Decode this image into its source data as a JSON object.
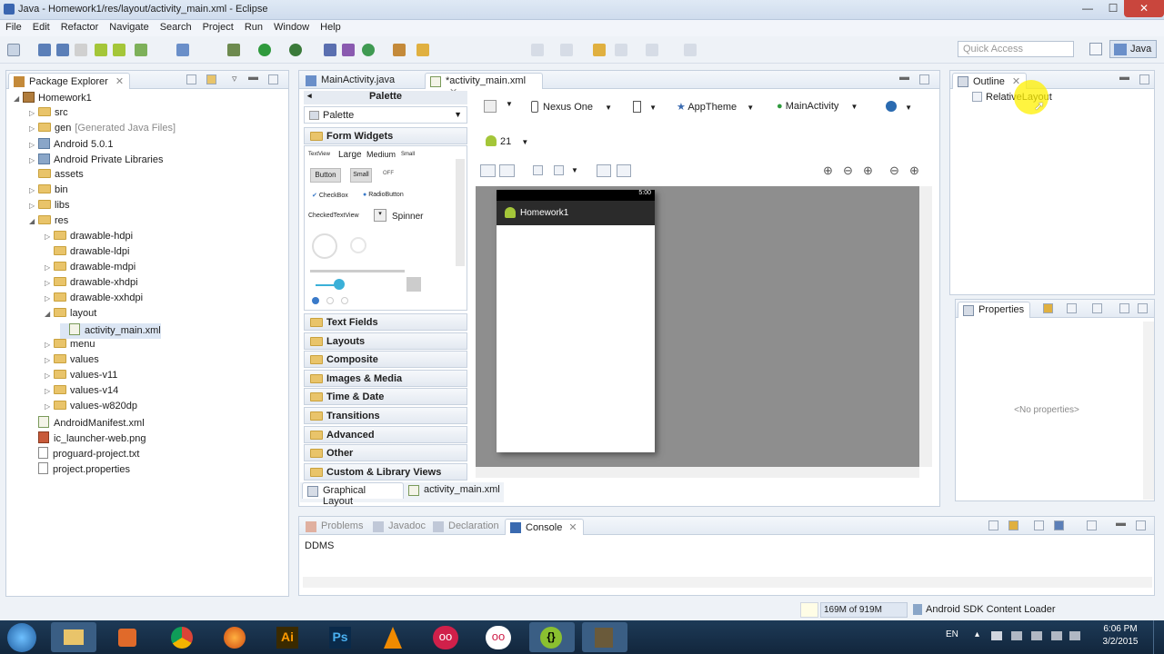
{
  "window": {
    "title": "Java - Homework1/res/layout/activity_main.xml - Eclipse",
    "minimize": "—",
    "maximize": "☐",
    "close": "✕"
  },
  "menu": [
    "File",
    "Edit",
    "Refactor",
    "Navigate",
    "Search",
    "Project",
    "Run",
    "Window",
    "Help"
  ],
  "quick_access": {
    "placeholder": "Quick Access"
  },
  "perspective": "Java",
  "package_explorer": {
    "title": "Package Explorer",
    "close": "✕",
    "tree": [
      {
        "label": "Homework1",
        "level": 0,
        "arrow": "◢",
        "icon": "project"
      },
      {
        "label": "src",
        "level": 1,
        "arrow": "▷",
        "icon": "folder"
      },
      {
        "label": "gen",
        "suffix": "[Generated Java Files]",
        "level": 1,
        "arrow": "▷",
        "icon": "folder"
      },
      {
        "label": "Android 5.0.1",
        "level": 1,
        "arrow": "▷",
        "icon": "lib"
      },
      {
        "label": "Android Private Libraries",
        "level": 1,
        "arrow": "▷",
        "icon": "lib"
      },
      {
        "label": "assets",
        "level": 1,
        "arrow": "",
        "icon": "folder"
      },
      {
        "label": "bin",
        "level": 1,
        "arrow": "▷",
        "icon": "folder"
      },
      {
        "label": "libs",
        "level": 1,
        "arrow": "▷",
        "icon": "folder"
      },
      {
        "label": "res",
        "level": 1,
        "arrow": "◢",
        "icon": "folder"
      },
      {
        "label": "drawable-hdpi",
        "level": 2,
        "arrow": "▷",
        "icon": "folder"
      },
      {
        "label": "drawable-ldpi",
        "level": 2,
        "arrow": "",
        "icon": "folder"
      },
      {
        "label": "drawable-mdpi",
        "level": 2,
        "arrow": "▷",
        "icon": "folder"
      },
      {
        "label": "drawable-xhdpi",
        "level": 2,
        "arrow": "▷",
        "icon": "folder"
      },
      {
        "label": "drawable-xxhdpi",
        "level": 2,
        "arrow": "▷",
        "icon": "folder"
      },
      {
        "label": "layout",
        "level": 2,
        "arrow": "◢",
        "icon": "folder"
      },
      {
        "label": "activity_main.xml",
        "level": 3,
        "arrow": "",
        "icon": "xml",
        "selected": true
      },
      {
        "label": "menu",
        "level": 2,
        "arrow": "▷",
        "icon": "folder"
      },
      {
        "label": "values",
        "level": 2,
        "arrow": "▷",
        "icon": "folder"
      },
      {
        "label": "values-v11",
        "level": 2,
        "arrow": "▷",
        "icon": "folder"
      },
      {
        "label": "values-v14",
        "level": 2,
        "arrow": "▷",
        "icon": "folder"
      },
      {
        "label": "values-w820dp",
        "level": 2,
        "arrow": "▷",
        "icon": "folder"
      },
      {
        "label": "AndroidManifest.xml",
        "level": 1,
        "arrow": "",
        "icon": "xml"
      },
      {
        "label": "ic_launcher-web.png",
        "level": 1,
        "arrow": "",
        "icon": "png"
      },
      {
        "label": "proguard-project.txt",
        "level": 1,
        "arrow": "",
        "icon": "file"
      },
      {
        "label": "project.properties",
        "level": 1,
        "arrow": "",
        "icon": "file"
      }
    ]
  },
  "editor": {
    "tabs": [
      {
        "label": "MainActivity.java"
      },
      {
        "label": "*activity_main.xml",
        "close": "✕"
      }
    ],
    "palette_header": "Palette",
    "palette_dropdown": "Palette",
    "palette_categories": [
      "Form Widgets",
      "Text Fields",
      "Layouts",
      "Composite",
      "Images & Media",
      "Time & Date",
      "Transitions",
      "Advanced",
      "Other",
      "Custom & Library Views"
    ],
    "form_widgets": {
      "textview": "TextView",
      "large": "Large",
      "medium": "Medium",
      "small": "Small",
      "button": "Button",
      "small_button": "Small",
      "toggle": "OFF",
      "checkbox": "CheckBox",
      "radio": "RadioButton",
      "checked_textview": "CheckedTextView",
      "spinner": "Spinner"
    },
    "device": "Nexus One",
    "theme": "AppTheme",
    "activity": "MainActivity",
    "api_level": "21",
    "preview": {
      "status_time": "5:00",
      "app_title": "Homework1"
    },
    "bottom_tabs": [
      "Graphical Layout",
      "activity_main.xml"
    ]
  },
  "outline": {
    "title": "Outline",
    "close": "✕",
    "root": "RelativeLayout"
  },
  "properties": {
    "title": "Properties",
    "empty": "<No properties>"
  },
  "console": {
    "tabs": [
      "Problems",
      "Javadoc",
      "Declaration",
      "Console"
    ],
    "close": "✕",
    "content": "DDMS"
  },
  "status": {
    "memory": "169M of 919M",
    "loader": "Android SDK Content Loader"
  },
  "taskbar": {
    "lang": "EN",
    "time": "6:06 PM",
    "date": "3/2/2015"
  }
}
